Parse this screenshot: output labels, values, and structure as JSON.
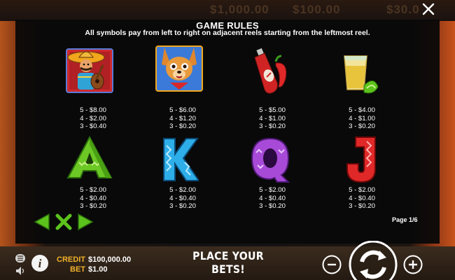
{
  "background": {
    "top_strip": [
      "$1,000.00",
      "$100.00",
      "$30.0"
    ]
  },
  "rules": {
    "title": "GAME RULES",
    "description": "All symbols pay from left to right on adjacent reels starting from the leftmost reel."
  },
  "symbols": [
    {
      "icon": "mariachi-icon",
      "pays": [
        "5 - $8.00",
        "4 - $2.00",
        "3 - $0.40"
      ]
    },
    {
      "icon": "chihuahua-icon",
      "pays": [
        "5 - $6.00",
        "4 - $1.20",
        "3 - $0.20"
      ]
    },
    {
      "icon": "hot-sauce-icon",
      "pays": [
        "5 - $5.00",
        "4 - $1.00",
        "3 - $0.20"
      ]
    },
    {
      "icon": "tequila-shot-icon",
      "pays": [
        "5 - $4.00",
        "4 - $1.00",
        "3 - $0.20"
      ]
    },
    {
      "icon": "letter-a-icon",
      "pays": [
        "5 - $2.00",
        "4 - $0.40",
        "3 - $0.20"
      ]
    },
    {
      "icon": "letter-k-icon",
      "pays": [
        "5 - $2.00",
        "4 - $0.40",
        "3 - $0.20"
      ]
    },
    {
      "icon": "letter-q-icon",
      "pays": [
        "5 - $2.00",
        "4 - $0.40",
        "3 - $0.20"
      ]
    },
    {
      "icon": "letter-j-icon",
      "pays": [
        "5 - $2.00",
        "4 - $0.40",
        "3 - $0.20"
      ]
    }
  ],
  "pagination": {
    "indicator": "Page 1/6"
  },
  "footer": {
    "credit_label": "CREDIT",
    "credit_value": "$100,000.00",
    "bet_label": "BET",
    "bet_value": "$1.00",
    "message": "PLACE YOUR BETS!"
  },
  "colors": {
    "accent_gold": "#f0b12c",
    "nav_green": "#5cc21c",
    "panel_bg": "#080808"
  }
}
